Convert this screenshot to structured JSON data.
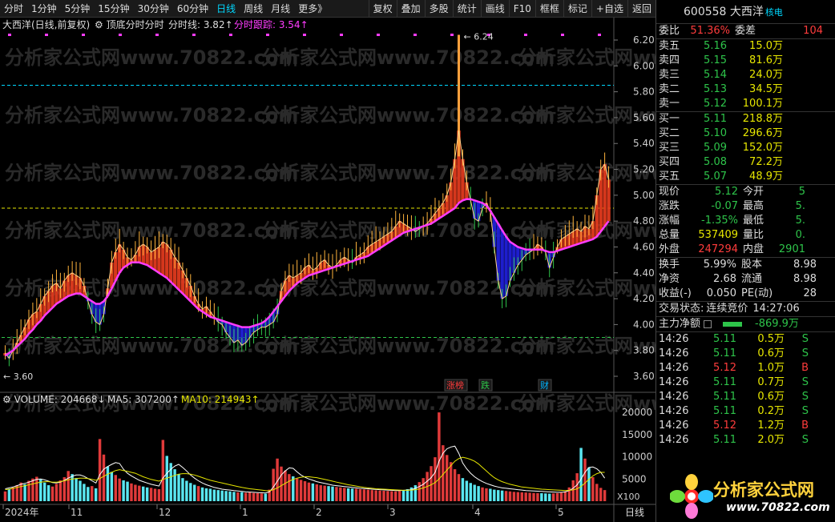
{
  "toolbar": {
    "periods": [
      "分时",
      "1分钟",
      "5分钟",
      "15分钟",
      "30分钟",
      "60分钟",
      "日线",
      "周线",
      "月线",
      "更多》"
    ],
    "active_period": "日线",
    "tools": [
      "复权",
      "叠加",
      "多股",
      "统计",
      "画线",
      "F10",
      "框框",
      "标记",
      "+自选",
      "返回"
    ]
  },
  "chart": {
    "legend_main": {
      "title": "大西洋(日线,前复权)",
      "indicator": "顶底分时分时",
      "fenshi_label": "分时线: 3.82",
      "gen_label": "分时跟踪: 3.54"
    },
    "y_axis": [
      "6.20",
      "6.00",
      "5.80",
      "5.60",
      "5.40",
      "5.20",
      "5.00",
      "4.80",
      "4.60",
      "4.40",
      "4.20",
      "4.00",
      "3.80",
      "3.60"
    ],
    "max_label": "6.24",
    "min_label": "3.60",
    "event_tags": [
      "涨榜",
      "跌",
      "财"
    ],
    "volume_legend": {
      "vol": "VOLUME: 204668",
      "ma5": "MA5: 307200",
      "ma10": "MA10: 214943"
    },
    "vol_axis": [
      "20000",
      "15000",
      "10000",
      "5000"
    ],
    "vol_unit": "X100",
    "x_axis": [
      "2024年",
      "11",
      "12",
      "1",
      "2",
      "3",
      "4",
      "5"
    ],
    "period_footer": "日线",
    "watermark": "分析家公式网www.70822.com"
  },
  "quote": {
    "code": "600558",
    "name": "大西洋",
    "tag": "核电",
    "weibi_label": "委比",
    "weibi": "51.36%",
    "weicha_label": "委差",
    "weicha": "104",
    "asks": [
      {
        "label": "卖五",
        "price": "5.16",
        "vol": "15.0万"
      },
      {
        "label": "卖四",
        "price": "5.15",
        "vol": "81.6万"
      },
      {
        "label": "卖三",
        "price": "5.14",
        "vol": "24.0万"
      },
      {
        "label": "卖二",
        "price": "5.13",
        "vol": "34.5万"
      },
      {
        "label": "卖一",
        "price": "5.12",
        "vol": "100.1万"
      }
    ],
    "bids": [
      {
        "label": "买一",
        "price": "5.11",
        "vol": "218.8万"
      },
      {
        "label": "买二",
        "price": "5.10",
        "vol": "296.6万"
      },
      {
        "label": "买三",
        "price": "5.09",
        "vol": "152.0万"
      },
      {
        "label": "买四",
        "price": "5.08",
        "vol": "72.2万"
      },
      {
        "label": "买五",
        "price": "5.07",
        "vol": "48.9万"
      }
    ],
    "stats": [
      {
        "l1": "现价",
        "v1": "5.12",
        "c1": "green",
        "l2": "今开",
        "v2": "5"
      },
      {
        "l1": "涨跌",
        "v1": "-0.07",
        "c1": "green",
        "l2": "最高",
        "v2": "5."
      },
      {
        "l1": "涨幅",
        "v1": "-1.35%",
        "c1": "green",
        "l2": "最低",
        "v2": "5."
      },
      {
        "l1": "总量",
        "v1": "537409",
        "c1": "yellow",
        "l2": "量比",
        "v2": "0."
      },
      {
        "l1": "外盘",
        "v1": "247294",
        "c1": "red",
        "l2": "内盘",
        "v2": "2901"
      }
    ],
    "stats2": [
      {
        "l1": "换手",
        "v1": "5.99%",
        "l2": "股本",
        "v2": "8.98"
      },
      {
        "l1": "净资",
        "v1": "2.68",
        "l2": "流通",
        "v2": "8.98"
      },
      {
        "l1": "收益(-)",
        "v1": "0.050",
        "l2": "PE(动)",
        "v2": "28"
      }
    ],
    "status_label": "交易状态:",
    "status": "连续竞价",
    "time": "14:27:06",
    "net_label": "主力净额",
    "net_value": "-869.9万",
    "ticks": [
      {
        "t": "14:26",
        "p": "5.11",
        "v": "0.5万",
        "bs": "S"
      },
      {
        "t": "14:26",
        "p": "5.11",
        "v": "0.6万",
        "bs": "S"
      },
      {
        "t": "14:26",
        "p": "5.12",
        "v": "1.0万",
        "bs": "B"
      },
      {
        "t": "14:26",
        "p": "5.11",
        "v": "0.7万",
        "bs": "S"
      },
      {
        "t": "14:26",
        "p": "5.11",
        "v": "0.6万",
        "bs": "S"
      },
      {
        "t": "14:26",
        "p": "5.11",
        "v": "0.2万",
        "bs": "S"
      },
      {
        "t": "14:26",
        "p": "5.12",
        "v": "1.2万",
        "bs": "B"
      },
      {
        "t": "14:26",
        "p": "5.11",
        "v": "2.0万",
        "bs": "S"
      }
    ]
  },
  "logo": {
    "text": "分析家公式网",
    "url": "www.70822.com"
  },
  "chart_data": {
    "type": "bar",
    "price_series": [
      3.78,
      3.74,
      3.8,
      3.86,
      3.92,
      3.98,
      4.04,
      4.08,
      4.1,
      4.16,
      4.22,
      4.26,
      4.3,
      4.32,
      4.28,
      4.34,
      4.38,
      4.4,
      4.38,
      4.36,
      4.3,
      4.18,
      4.08,
      4.02,
      4.0,
      4.08,
      4.28,
      4.48,
      4.56,
      4.62,
      4.58,
      4.52,
      4.5,
      4.54,
      4.6,
      4.62,
      4.6,
      4.56,
      4.58,
      4.6,
      4.64,
      4.62,
      4.58,
      4.52,
      4.48,
      4.42,
      4.36,
      4.3,
      4.22,
      4.16,
      4.12,
      4.14,
      4.1,
      4.06,
      4.02,
      4.0,
      3.94,
      3.9,
      3.86,
      3.88,
      3.84,
      3.86,
      3.9,
      3.94,
      3.96,
      3.98,
      3.98,
      4.0,
      4.02,
      4.08,
      4.26,
      4.34,
      4.38,
      4.36,
      4.38,
      4.4,
      4.44,
      4.46,
      4.42,
      4.44,
      4.48,
      4.5,
      4.46,
      4.44,
      4.46,
      4.5,
      4.52,
      4.5,
      4.48,
      4.52,
      4.54,
      4.56,
      4.6,
      4.62,
      4.64,
      4.66,
      4.68,
      4.7,
      4.72,
      4.76,
      4.8,
      4.78,
      4.76,
      4.74,
      4.72,
      4.74,
      4.76,
      4.78,
      4.82,
      4.86,
      4.9,
      4.94,
      5.0,
      5.1,
      5.28,
      5.5,
      5.28,
      5.1,
      4.96,
      4.82,
      4.8,
      4.9,
      4.94,
      4.88,
      4.6,
      4.34,
      4.2,
      4.22,
      4.34,
      4.4,
      4.46,
      4.5,
      4.54,
      4.56,
      4.58,
      4.62,
      4.6,
      4.56,
      4.44,
      4.52,
      4.6,
      4.66,
      4.68,
      4.7,
      4.72,
      4.74,
      4.72,
      4.76,
      4.74,
      4.8,
      5.0,
      5.2,
      5.24,
      5.12
    ],
    "ma_series": [
      3.76,
      3.78,
      3.8,
      3.83,
      3.86,
      3.89,
      3.93,
      3.96,
      4.0,
      4.03,
      4.07,
      4.1,
      4.13,
      4.16,
      4.18,
      4.2,
      4.22,
      4.23,
      4.24,
      4.24,
      4.22,
      4.2,
      4.18,
      4.16,
      4.16,
      4.18,
      4.22,
      4.28,
      4.34,
      4.4,
      4.44,
      4.46,
      4.48,
      4.48,
      4.48,
      4.47,
      4.46,
      4.44,
      4.42,
      4.4,
      4.38,
      4.36,
      4.33,
      4.3,
      4.27,
      4.24,
      4.21,
      4.18,
      4.15,
      4.12,
      4.1,
      4.08,
      4.06,
      4.05,
      4.04,
      4.03,
      4.02,
      4.01,
      4.0,
      3.99,
      3.98,
      3.98,
      3.98,
      3.99,
      4.0,
      4.01,
      4.03,
      4.06,
      4.1,
      4.14,
      4.18,
      4.22,
      4.26,
      4.29,
      4.32,
      4.34,
      4.36,
      4.38,
      4.39,
      4.4,
      4.41,
      4.42,
      4.43,
      4.44,
      4.45,
      4.46,
      4.47,
      4.48,
      4.49,
      4.5,
      4.51,
      4.52,
      4.53,
      4.55,
      4.57,
      4.59,
      4.61,
      4.63,
      4.65,
      4.67,
      4.69,
      4.71,
      4.72,
      4.73,
      4.74,
      4.75,
      4.76,
      4.77,
      4.78,
      4.8,
      4.82,
      4.84,
      4.86,
      4.88,
      4.9,
      4.94,
      4.96,
      4.97,
      4.97,
      4.96,
      4.95,
      4.94,
      4.92,
      4.88,
      4.83,
      4.78,
      4.73,
      4.68,
      4.64,
      4.62,
      4.6,
      4.59,
      4.58,
      4.58,
      4.58,
      4.58,
      4.58,
      4.57,
      4.56,
      4.56,
      4.57,
      4.58,
      4.59,
      4.6,
      4.61,
      4.62,
      4.63,
      4.64,
      4.65,
      4.66,
      4.68,
      4.72,
      4.76,
      4.8
    ],
    "volume_series": [
      2200,
      2800,
      3100,
      3600,
      4200,
      3800,
      4600,
      5100,
      5500,
      4900,
      4200,
      3600,
      3300,
      3900,
      4700,
      5400,
      6800,
      6100,
      5200,
      4600,
      3900,
      3200,
      3400,
      2900,
      14000,
      10500,
      7800,
      6600,
      5900,
      5100,
      4700,
      4400,
      4000,
      3700,
      3500,
      3300,
      3100,
      3000,
      2800,
      2700,
      13800,
      10200,
      8600,
      7200,
      6100,
      5200,
      4600,
      4100,
      3700,
      3400,
      3100,
      2900,
      2800,
      2600,
      2500,
      2400,
      2300,
      2200,
      2100,
      2000,
      2050,
      1900,
      2000,
      1850,
      1800,
      1750,
      1700,
      2600,
      7300,
      9600,
      7800,
      6900,
      6100,
      5600,
      5100,
      4800,
      4500,
      4200,
      4000,
      3800,
      3600,
      3500,
      3400,
      3300,
      3200,
      3100,
      3000,
      2900,
      2850,
      2800,
      2700,
      2650,
      2600,
      2500,
      2450,
      2400,
      2350,
      2300,
      2250,
      2200,
      2300,
      2500,
      2700,
      3100,
      3600,
      4300,
      5200,
      6600,
      7900,
      9900,
      20000,
      12600,
      10400,
      8800,
      7200,
      6100,
      5200,
      4600,
      4100,
      3700,
      3400,
      3100,
      2900,
      2800,
      2600,
      2500,
      2400,
      2300,
      2200,
      2100,
      2050,
      2000,
      1950,
      1900,
      1850,
      1800,
      1800,
      1750,
      1700,
      1750,
      1800,
      1900,
      2200,
      3100,
      4700,
      6300,
      12000,
      9600,
      7600,
      5400,
      3900,
      3000,
      2500
    ],
    "volume_up": [
      1,
      0,
      1,
      1,
      1,
      0,
      1,
      1,
      1,
      0,
      0,
      0,
      1,
      1,
      1,
      1,
      1,
      0,
      0,
      0,
      0,
      0,
      1,
      0,
      1,
      1,
      0,
      0,
      1,
      1,
      0,
      0,
      1,
      1,
      1,
      0,
      0,
      1,
      1,
      1,
      1,
      0,
      0,
      0,
      0,
      0,
      0,
      0,
      0,
      1,
      0,
      0,
      0,
      0,
      0,
      0,
      0,
      0,
      0,
      1,
      0,
      1,
      1,
      1,
      1,
      1,
      0,
      1,
      1,
      1,
      1,
      1,
      1,
      0,
      1,
      1,
      1,
      1,
      0,
      1,
      1,
      1,
      0,
      0,
      1,
      1,
      1,
      0,
      0,
      1,
      1,
      1,
      1,
      1,
      1,
      1,
      1,
      1,
      1,
      1,
      1,
      0,
      0,
      0,
      0,
      1,
      1,
      1,
      1,
      1,
      1,
      1,
      1,
      1,
      1,
      1,
      0,
      0,
      0,
      0,
      0,
      1,
      1,
      0,
      0,
      0,
      0,
      1,
      1,
      1,
      1,
      1,
      1,
      1,
      1,
      1,
      0,
      0,
      0,
      1,
      1,
      1,
      1,
      1,
      1,
      1,
      0,
      1,
      0,
      1,
      1,
      1,
      1,
      0
    ],
    "ma5_vol": [
      2800,
      3000,
      3200,
      3500,
      3800,
      4000,
      4300,
      4600,
      4900,
      5000,
      4800,
      4500,
      4200,
      4100,
      4300,
      4700,
      5200,
      5600,
      5900,
      5900,
      5600,
      5100,
      4600,
      4100,
      6000,
      7200,
      7800,
      8300,
      8700,
      8500,
      7200,
      6300,
      5700,
      5200,
      4700,
      4400,
      4100,
      3800,
      3600,
      3400,
      5200,
      6300,
      7200,
      7900,
      8300,
      7600,
      6800,
      5900,
      5200,
      4600,
      4100,
      3700,
      3400,
      3100,
      2900,
      2700,
      2600,
      2500,
      2400,
      2300,
      2200,
      2100,
      2050,
      2000,
      1950,
      1900,
      1850,
      2100,
      3200,
      4500,
      5900,
      6800,
      7500,
      7400,
      6600,
      5900,
      5400,
      5000,
      4700,
      4400,
      4200,
      4000,
      3800,
      3600,
      3500,
      3400,
      3300,
      3200,
      3100,
      3000,
      2900,
      2850,
      2800,
      2700,
      2650,
      2600,
      2550,
      2500,
      2450,
      2400,
      2400,
      2450,
      2500,
      2600,
      2900,
      3300,
      3800,
      4500,
      5300,
      6500,
      9000,
      10800,
      11800,
      12200,
      12400,
      10800,
      8600,
      7300,
      6300,
      5500,
      4900,
      4400,
      4000,
      3700,
      3400,
      3200,
      3000,
      2900,
      2800,
      2700,
      2600,
      2500,
      2400,
      2350,
      2300,
      2250,
      2200,
      2150,
      2100,
      2050,
      2000,
      2000,
      2100,
      2400,
      2900,
      3700,
      5000,
      6500,
      7600,
      7700,
      7300,
      6500,
      5200
    ],
    "ma10_vol": [
      2600,
      2700,
      2900,
      3100,
      3300,
      3500,
      3700,
      3900,
      4100,
      4300,
      4400,
      4400,
      4300,
      4300,
      4400,
      4600,
      4800,
      5000,
      5100,
      5200,
      5200,
      5100,
      4900,
      4700,
      5100,
      5600,
      6100,
      6500,
      6900,
      7100,
      6900,
      6700,
      6500,
      6300,
      5900,
      5500,
      5200,
      4900,
      4700,
      4500,
      4900,
      5200,
      5500,
      5800,
      6100,
      6200,
      6200,
      6100,
      5900,
      5600,
      5300,
      5000,
      4700,
      4500,
      4300,
      4100,
      3900,
      3700,
      3500,
      3300,
      3100,
      2950,
      2800,
      2700,
      2600,
      2500,
      2400,
      2350,
      2600,
      3000,
      3500,
      4000,
      4500,
      4900,
      5200,
      5400,
      5500,
      5500,
      5400,
      5300,
      5100,
      4900,
      4700,
      4500,
      4300,
      4100,
      3900,
      3700,
      3550,
      3400,
      3250,
      3100,
      3000,
      2900,
      2800,
      2750,
      2700,
      2650,
      2600,
      2550,
      2500,
      2450,
      2450,
      2500,
      2600,
      2750,
      3000,
      3300,
      3700,
      4200,
      5000,
      6000,
      7000,
      8000,
      9000,
      9600,
      9900,
      9700,
      9400,
      9000,
      8400,
      7600,
      6800,
      6000,
      5300,
      4800,
      4400,
      4100,
      3800,
      3600,
      3400,
      3200,
      3100,
      3000,
      2900,
      2800,
      2700,
      2650,
      2600,
      2550,
      2500,
      2450,
      2400,
      2450,
      2550,
      2800,
      3300,
      4100,
      4900,
      5700,
      6200,
      6500,
      6500
    ]
  }
}
